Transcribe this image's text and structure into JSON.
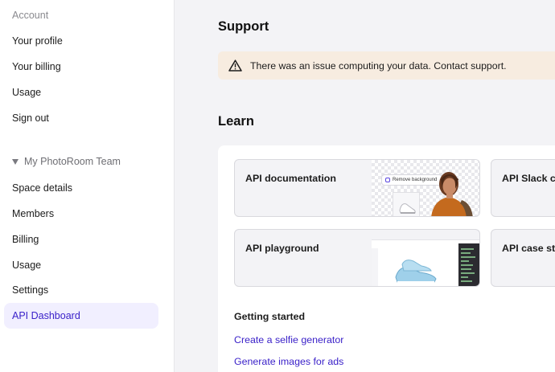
{
  "sidebar": {
    "account_label": "Account",
    "account_items": [
      "Your profile",
      "Your billing",
      "Usage",
      "Sign out"
    ],
    "team_label": "My PhotoRoom Team",
    "team_items": [
      "Space details",
      "Members",
      "Billing",
      "Usage",
      "Settings",
      "API Dashboard"
    ],
    "active_item": "API Dashboard"
  },
  "support": {
    "title": "Support",
    "alert_text": "There was an issue computing your data. Contact support."
  },
  "learn": {
    "title": "Learn",
    "cards": [
      "API documentation",
      "API Slack co",
      "API playground",
      "API case stu"
    ],
    "thumbnail_pill": "Remove background"
  },
  "getting_started": {
    "title": "Getting started",
    "links": [
      "Create a selfie generator",
      "Generate images for ads"
    ]
  },
  "colors": {
    "accent": "#3b22c9",
    "active_bg": "#f1efff",
    "alert_bg": "#f7ece0",
    "page_bg": "#f3f3f6"
  }
}
